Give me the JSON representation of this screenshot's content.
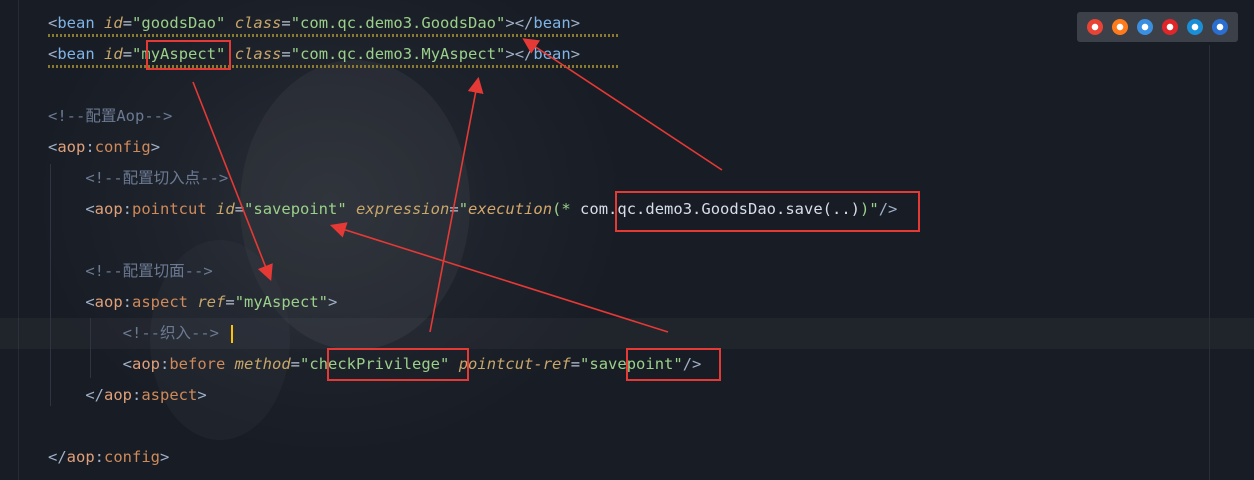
{
  "editor": {
    "lines": [
      {
        "id": "line-1",
        "parts": [
          [
            "b",
            "<"
          ],
          [
            "t",
            "bean "
          ],
          [
            "a",
            "id"
          ],
          [
            "eq",
            "="
          ],
          [
            "s",
            "\"goodsDao\""
          ],
          [
            "v",
            " "
          ],
          [
            "a",
            "class"
          ],
          [
            "eq",
            "="
          ],
          [
            "s",
            "\"com.qc.demo3.GoodsDao\""
          ],
          [
            "b",
            ">"
          ],
          [
            "b",
            "</"
          ],
          [
            "t",
            "bean"
          ],
          [
            "b",
            ">"
          ]
        ]
      },
      {
        "id": "line-2",
        "parts": [
          [
            "b",
            "<"
          ],
          [
            "t",
            "bean "
          ],
          [
            "a",
            "id"
          ],
          [
            "eq",
            "="
          ],
          [
            "s",
            "\""
          ],
          [
            "s",
            "myAspect"
          ],
          [
            "s",
            "\""
          ],
          [
            "v",
            " "
          ],
          [
            "a",
            "class"
          ],
          [
            "eq",
            "="
          ],
          [
            "s",
            "\"com.qc.demo3.MyAspect\""
          ],
          [
            "b",
            ">"
          ],
          [
            "b",
            "</"
          ],
          [
            "t",
            "bean"
          ],
          [
            "b",
            ">"
          ]
        ]
      },
      {
        "id": "line-3",
        "parts": []
      },
      {
        "id": "line-4",
        "parts": [
          [
            "c",
            "<!--配置Aop-->"
          ]
        ]
      },
      {
        "id": "line-5",
        "parts": [
          [
            "b",
            "<"
          ],
          [
            "ns",
            "aop"
          ],
          [
            "b",
            ":"
          ],
          [
            "k",
            "config"
          ],
          [
            "b",
            ">"
          ]
        ]
      },
      {
        "id": "line-6",
        "parts": [
          [
            "v",
            "    "
          ],
          [
            "c",
            "<!--配置切入点-->"
          ]
        ]
      },
      {
        "id": "line-7",
        "parts": [
          [
            "v",
            "    "
          ],
          [
            "b",
            "<"
          ],
          [
            "ns",
            "aop"
          ],
          [
            "b",
            ":"
          ],
          [
            "k",
            "pointcut "
          ],
          [
            "a",
            "id"
          ],
          [
            "eq",
            "="
          ],
          [
            "s",
            "\"savepoint\""
          ],
          [
            "v",
            " "
          ],
          [
            "a",
            "expression"
          ],
          [
            "eq",
            "="
          ],
          [
            "s",
            "\""
          ],
          [
            "f",
            "execution"
          ],
          [
            "s",
            "(* "
          ],
          [
            "v",
            "com.qc.demo3.GoodsDao.save(..)"
          ],
          [
            "s",
            ")\""
          ],
          [
            "b",
            "/>"
          ]
        ]
      },
      {
        "id": "line-8",
        "parts": []
      },
      {
        "id": "line-9",
        "parts": [
          [
            "v",
            "    "
          ],
          [
            "c",
            "<!--配置切面-->"
          ]
        ]
      },
      {
        "id": "line-10",
        "parts": [
          [
            "v",
            "    "
          ],
          [
            "b",
            "<"
          ],
          [
            "ns",
            "aop"
          ],
          [
            "b",
            ":"
          ],
          [
            "k",
            "aspect "
          ],
          [
            "a",
            "ref"
          ],
          [
            "eq",
            "="
          ],
          [
            "s",
            "\"myAspect\""
          ],
          [
            "b",
            ">"
          ]
        ]
      },
      {
        "id": "line-11",
        "parts": [
          [
            "v",
            "        "
          ],
          [
            "c",
            "<!--织入-->"
          ]
        ]
      },
      {
        "id": "line-12",
        "parts": [
          [
            "v",
            "        "
          ],
          [
            "b",
            "<"
          ],
          [
            "ns",
            "aop"
          ],
          [
            "b",
            ":"
          ],
          [
            "k",
            "before "
          ],
          [
            "a",
            "method"
          ],
          [
            "eq",
            "="
          ],
          [
            "s",
            "\""
          ],
          [
            "s",
            "checkPrivilege"
          ],
          [
            "s",
            "\""
          ],
          [
            "v",
            " "
          ],
          [
            "a",
            "pointcut-ref"
          ],
          [
            "eq",
            "="
          ],
          [
            "s",
            "\""
          ],
          [
            "s",
            "savepoint"
          ],
          [
            "s",
            "\""
          ],
          [
            "b",
            "/>"
          ]
        ]
      },
      {
        "id": "line-13",
        "parts": [
          [
            "v",
            "    "
          ],
          [
            "b",
            "</"
          ],
          [
            "ns",
            "aop"
          ],
          [
            "b",
            ":"
          ],
          [
            "k",
            "aspect"
          ],
          [
            "b",
            ">"
          ]
        ]
      },
      {
        "id": "line-14",
        "parts": []
      },
      {
        "id": "line-15",
        "parts": [
          [
            "b",
            "</"
          ],
          [
            "ns",
            "aop"
          ],
          [
            "b",
            ":"
          ],
          [
            "k",
            "config"
          ],
          [
            "b",
            ">"
          ]
        ]
      }
    ]
  },
  "browser_bar": {
    "icons": [
      "chrome-icon",
      "firefox-icon",
      "safari-icon",
      "opera-icon",
      "ie-icon",
      "edge-icon"
    ],
    "colors": [
      "#e84335",
      "#ff7a1a",
      "#3a8fe0",
      "#e0262b",
      "#1a8fd8",
      "#2a6fd0"
    ]
  },
  "annotations": {
    "box_color": "#e53935",
    "arrow_color": "#e53935"
  },
  "token_colors": {
    "b": "#9fb0c8",
    "t": "#7fb4e6",
    "ns": "#e0a17a",
    "k": "#cf8a5a",
    "a": "#c7a66a",
    "eq": "#b8c2d2",
    "s": "#9ad08a",
    "v": "#d8dee9",
    "c": "#6b7a92",
    "f": "#d3a76b"
  }
}
